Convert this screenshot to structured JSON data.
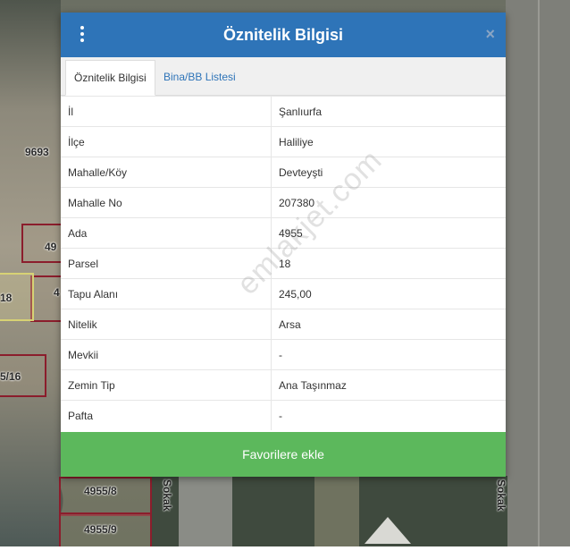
{
  "modal": {
    "title": "Öznitelik Bilgisi",
    "close_glyph": "×",
    "menu_icon": "vertical-dots-icon",
    "tabs": [
      {
        "label": "Öznitelik Bilgisi",
        "active": true
      },
      {
        "label": "Bina/BB Listesi",
        "active": false
      }
    ],
    "rows": [
      {
        "key": "İl",
        "value": "Şanlıurfa"
      },
      {
        "key": "İlçe",
        "value": "Haliliye"
      },
      {
        "key": "Mahalle/Köy",
        "value": "Devteyşti"
      },
      {
        "key": "Mahalle No",
        "value": "207380"
      },
      {
        "key": "Ada",
        "value": "4955"
      },
      {
        "key": "Parsel",
        "value": "18"
      },
      {
        "key": "Tapu Alanı",
        "value": "245,00"
      },
      {
        "key": "Nitelik",
        "value": "Arsa"
      },
      {
        "key": "Mevkii",
        "value": "-"
      },
      {
        "key": "Zemin Tip",
        "value": "Ana Taşınmaz"
      },
      {
        "key": "Pafta",
        "value": "-"
      }
    ],
    "favorite_button": "Favorilere ekle",
    "watermark": "emlakjet.com"
  },
  "map": {
    "labels": {
      "block": "9693",
      "p1": "49",
      "p2": "4",
      "p3": "18",
      "p4": "5/16",
      "p5": "4955/8",
      "p6": "4955/9",
      "street_left": "Sokak",
      "street_right": "Sokak"
    }
  },
  "colors": {
    "header": "#2e74b8",
    "favorite_button": "#5cb85c",
    "parcel_border": "#8b1d2c",
    "highlight_parcel": "#d7d274"
  }
}
